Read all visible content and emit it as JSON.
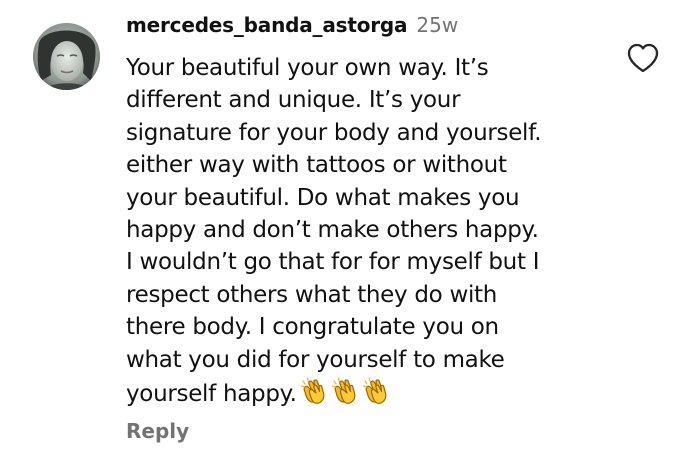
{
  "comment": {
    "username": "mercedes_banda_astorga",
    "timestamp": "25w",
    "lines": [
      "Your beautiful your own way. It’s",
      "different and unique. It’s your",
      "signature for your body and yourself.",
      "either way with tattoos or without",
      "your beautiful. Do what makes you",
      "happy and don’t make others happy.",
      "I wouldn’t go that for for myself but I",
      "respect others what they do with",
      "there body. I congratulate you on",
      "what you did for yourself to make",
      "yourself happy."
    ],
    "emoji": [
      "👏",
      "👏",
      "👏"
    ],
    "reply_label": "Reply"
  },
  "icons": {
    "like": "heart-outline-icon",
    "clap": "clapping-hands-icon"
  },
  "colors": {
    "text": "#111111",
    "secondary_text": "#737373",
    "heart_outline": "#262626",
    "clap_yellow": "#f4b92b"
  }
}
